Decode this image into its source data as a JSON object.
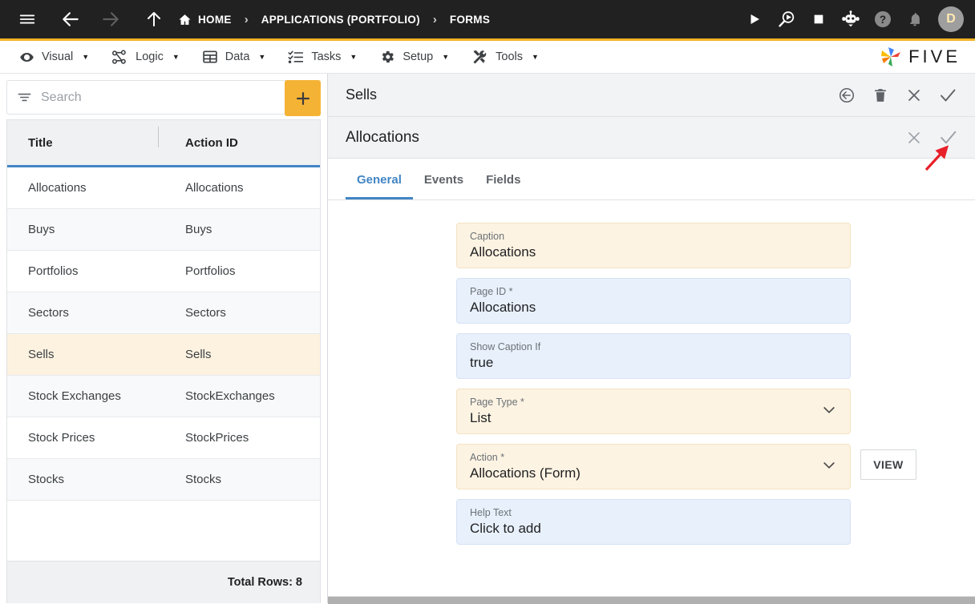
{
  "topbar": {
    "icons": [
      {
        "name": "hamburger-menu-icon",
        "label": "Menu"
      },
      {
        "name": "back-arrow-icon",
        "label": "Back"
      },
      {
        "name": "forward-arrow-icon",
        "label": "Forward"
      },
      {
        "name": "up-arrow-icon",
        "label": "Up"
      }
    ],
    "breadcrumbs": [
      {
        "label": "HOME",
        "icon": "home-icon"
      },
      {
        "label": "APPLICATIONS (PORTFOLIO)",
        "icon": ""
      },
      {
        "label": "FORMS",
        "icon": ""
      }
    ],
    "separator": "›",
    "actions": [
      {
        "name": "run-icon",
        "label": "Run"
      },
      {
        "name": "debug-icon",
        "label": "Debug"
      },
      {
        "name": "stop-icon",
        "label": "Stop"
      },
      {
        "name": "chatbot-icon",
        "label": "Assistant"
      },
      {
        "name": "help-icon",
        "label": "Help"
      },
      {
        "name": "notifications-bell-icon",
        "label": "Notifications"
      }
    ],
    "avatar_initial": "D",
    "accent_gold": "#f2b324"
  },
  "menubar": {
    "items": [
      {
        "label": "Visual",
        "icon": "eye-icon"
      },
      {
        "label": "Logic",
        "icon": "nodes-icon"
      },
      {
        "label": "Data",
        "icon": "table-icon"
      },
      {
        "label": "Tasks",
        "icon": "checklist-icon"
      },
      {
        "label": "Setup",
        "icon": "gear-icon"
      },
      {
        "label": "Tools",
        "icon": "tools-icon"
      }
    ],
    "caret": "▼",
    "brand": "FIVE"
  },
  "sidebar": {
    "search": {
      "value": "",
      "placeholder": "Search"
    },
    "add_button_label": "+",
    "columns": [
      "Title",
      "Action ID"
    ],
    "rows": [
      {
        "title": "Allocations",
        "action_id": "Allocations"
      },
      {
        "title": "Buys",
        "action_id": "Buys"
      },
      {
        "title": "Portfolios",
        "action_id": "Portfolios"
      },
      {
        "title": "Sectors",
        "action_id": "Sectors"
      },
      {
        "title": "Sells",
        "action_id": "Sells"
      },
      {
        "title": "Stock Exchanges",
        "action_id": "StockExchanges"
      },
      {
        "title": "Stock Prices",
        "action_id": "StockPrices"
      },
      {
        "title": "Stocks",
        "action_id": "Stocks"
      }
    ],
    "selected_index": 4,
    "footer": "Total Rows: 8"
  },
  "detail": {
    "title": "Sells",
    "header_actions": [
      {
        "name": "undo-circle-icon",
        "label": "Undo"
      },
      {
        "name": "delete-trash-icon",
        "label": "Delete"
      },
      {
        "name": "close-icon",
        "label": "Close"
      },
      {
        "name": "save-check-icon",
        "label": "Save"
      }
    ],
    "sub_title": "Allocations",
    "sub_actions": [
      {
        "name": "close-icon",
        "label": "Close"
      },
      {
        "name": "save-check-icon",
        "label": "Save"
      }
    ],
    "tabs": [
      {
        "label": "General",
        "active": true
      },
      {
        "label": "Events",
        "active": false
      },
      {
        "label": "Fields",
        "active": false
      }
    ],
    "fields": [
      {
        "label": "Caption",
        "value": "Allocations",
        "style": "amber",
        "dropdown": false,
        "button": ""
      },
      {
        "label": "Page ID *",
        "value": "Allocations",
        "style": "blue",
        "dropdown": false,
        "button": ""
      },
      {
        "label": "Show Caption If",
        "value": "true",
        "style": "blue",
        "dropdown": false,
        "button": ""
      },
      {
        "label": "Page Type *",
        "value": "List",
        "style": "amber",
        "dropdown": true,
        "button": ""
      },
      {
        "label": "Action *",
        "value": "Allocations (Form)",
        "style": "amber",
        "dropdown": true,
        "button": "VIEW"
      },
      {
        "label": "Help Text",
        "value": "Click to add",
        "style": "blue",
        "dropdown": false,
        "button": ""
      }
    ]
  },
  "annotation": {
    "type": "arrow",
    "color": "#e8202a",
    "points_at": "save-check-icon"
  },
  "colors": {
    "accent_gold": "#f2b324",
    "accent_blue": "#4285c5",
    "selected_row": "#fdf2e0",
    "field_blue": "#e8f0fb",
    "field_amber": "#fdf3e2",
    "topbar_bg": "#212121"
  }
}
